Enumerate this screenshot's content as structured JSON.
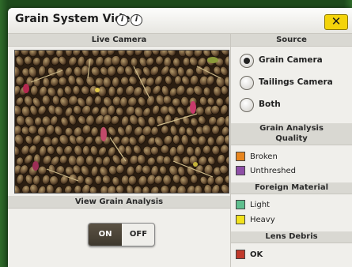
{
  "dialog": {
    "title": "Grain System Video",
    "info_icon_1": "i",
    "info_icon_2": "i",
    "close_label": "✕"
  },
  "left_panel": {
    "header": "Live Camera",
    "view_analysis_header": "View Grain Analysis",
    "toggle": {
      "on_label": "ON",
      "off_label": "OFF",
      "selected": "ON"
    }
  },
  "source": {
    "header": "Source",
    "options": [
      {
        "label": "Grain Camera",
        "selected": true
      },
      {
        "label": "Tailings Camera",
        "selected": false
      },
      {
        "label": "Both",
        "selected": false
      }
    ]
  },
  "grain_analysis": {
    "header": "Grain Analysis",
    "sections": [
      {
        "title": "Quality",
        "items": [
          {
            "label": "Broken",
            "color": "#e8861f"
          },
          {
            "label": "Unthreshed",
            "color": "#8e4fa6"
          }
        ]
      },
      {
        "title": "Foreign Material",
        "items": [
          {
            "label": "Light",
            "color": "#5fbf8e"
          },
          {
            "label": "Heavy",
            "color": "#f2e21c"
          }
        ]
      },
      {
        "title": "Lens Debris",
        "items": [
          {
            "label": "OK",
            "color": "#c0392b",
            "bold": true
          }
        ]
      }
    ]
  },
  "colors": {
    "close_button": "#f4d40a",
    "toggle_on": "#4a4337"
  }
}
